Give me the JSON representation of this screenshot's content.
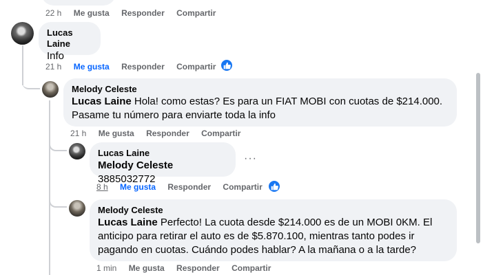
{
  "theme": {
    "link_blue": "#0866ff",
    "bubble_bg": "#f0f2f5",
    "meta_gray": "#65676b",
    "like_badge": "#1877f2"
  },
  "top_meta": {
    "time": "22 h",
    "like": "Me gusta",
    "reply": "Responder",
    "share": "Compartir"
  },
  "comments": [
    {
      "author": "Lucas Laine",
      "text": "Info",
      "meta": {
        "time": "21 h",
        "like": "Me gusta",
        "reply": "Responder",
        "share": "Compartir"
      },
      "reactions": "like-icon"
    },
    {
      "author": "Melody Celeste",
      "mention": "Lucas Laine",
      "text_line1": " Hola! como estas? Es para un FIAT MOBI con cuotas de $214.000.",
      "text_line2": "Pasame tu número para enviarte toda la info",
      "meta": {
        "time": "21 h",
        "like": "Me gusta",
        "reply": "Responder",
        "share": "Compartir"
      }
    },
    {
      "author": "Lucas Laine",
      "mention": "Melody Celeste",
      "text": " 3885032772",
      "more": "···",
      "meta": {
        "time": "8 h",
        "like": "Me gusta",
        "reply": "Responder",
        "share": "Compartir"
      },
      "reactions": "like-icon"
    },
    {
      "author": "Melody Celeste",
      "mention": "Lucas Laine",
      "text_line1": " Perfecto! La cuota desde $214.000 es de un MOBI 0KM. El",
      "text_line2": "anticipo para retirar el auto es de $5.870.100, mientras tanto podes ir",
      "text_line3": "pagando en cuotas. Cuándo podes hablar? A la mañana o a la tarde?",
      "meta": {
        "time": "1 min",
        "like": "Me gusta",
        "reply": "Responder",
        "share": "Compartir"
      }
    }
  ]
}
